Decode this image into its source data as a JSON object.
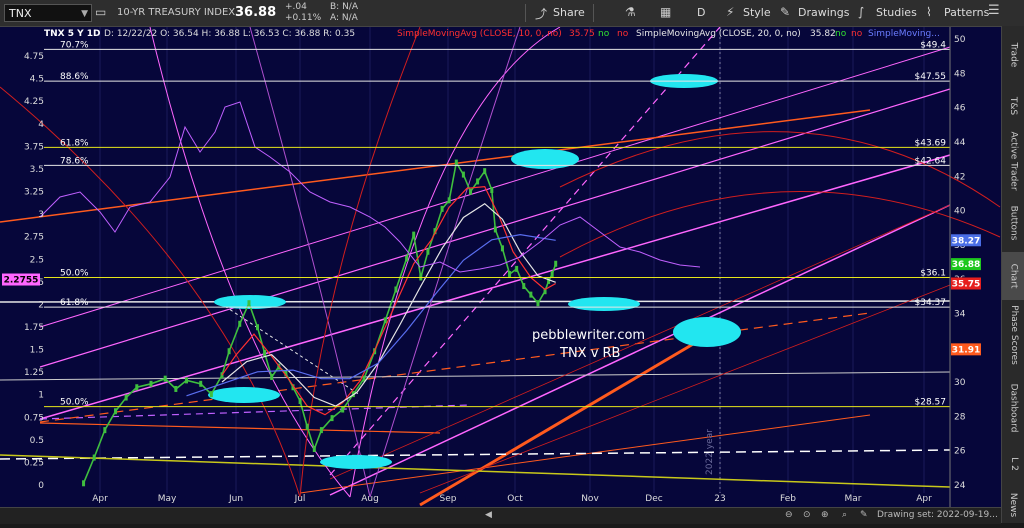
{
  "topbar": {
    "symbol": "TNX",
    "description": "10-YR TREASURY INDEX",
    "last": "36.88",
    "change": "+.04",
    "change_pct": "+0.11%",
    "bid_label": "B: N/A",
    "ask_label": "A: N/A",
    "share_label": "Share",
    "period_label": "D",
    "style_label": "Style",
    "drawings_label": "Drawings",
    "studies_label": "Studies",
    "patterns_label": "Patterns"
  },
  "sidebar": {
    "tabs": [
      "Trade",
      "T&S",
      "Active Trader",
      "Buttons",
      "Chart",
      "Phase Scores",
      "Dashboard",
      "L 2",
      "News"
    ]
  },
  "bottombar": {
    "drawing_set": "Drawing set: 2022-09-19..."
  },
  "header": {
    "title": "TNX 5 Y 1D",
    "ohlc": "D: 12/22/22  O: 36.54  H: 36.88  L: 36.53  C: 36.88  R: 0.35",
    "sma10_label": "SimpleMovingAvg (CLOSE, 10, 0, no)",
    "sma10_value": "35.75",
    "sma20_label": "SimpleMovingAvg (CLOSE, 20, 0, no)",
    "sma20_value": "35.82",
    "no": "no",
    "sma_trunc": "SimpleMoving..."
  },
  "watermark": {
    "line1": "pebblewriter.com",
    "line2": "TNX v RB",
    "year": "2022 year"
  },
  "colors": {
    "bg": "#06063a",
    "magenta": "#ff66ff",
    "orange": "#ff5a1e",
    "yellow": "#e6e61a",
    "cyan": "#22e6f0",
    "white": "#e6e6e6",
    "red": "#d21e1e",
    "blue": "#5a6ef0"
  },
  "chart_data": {
    "type": "line",
    "title": "TNX 5 Y 1D",
    "xlabel": "",
    "ylabel": "",
    "x": [
      "Apr",
      "May",
      "Jun",
      "Jul",
      "Aug",
      "Sep",
      "Oct",
      "Nov",
      "Dec",
      "23",
      "Feb",
      "Mar",
      "Apr"
    ],
    "right_axis_ticks": [
      "24",
      "26",
      "28",
      "30",
      "32",
      "34",
      "36",
      "38",
      "40",
      "42",
      "44",
      "46",
      "48",
      "50"
    ],
    "ylim": [
      24,
      50
    ],
    "left_axis_ticks": [
      "0",
      "0.25",
      "0.5",
      "0.75",
      "1",
      "1.25",
      "1.5",
      "1.75",
      "2",
      "2.25",
      "2.5",
      "2.75",
      "3",
      "3.25",
      "3.5",
      "3.75",
      "4",
      "4.25",
      "4.5",
      "4.75"
    ],
    "left_ylim": [
      0,
      4.75
    ],
    "fib_levels": [
      {
        "label": "70.7%",
        "value": 49.4,
        "right_label": "$49.4"
      },
      {
        "label": "88.6%",
        "value": 47.55,
        "right_label": "$47.55"
      },
      {
        "label": "61.8%",
        "value": 43.69,
        "right_label": "$43.69"
      },
      {
        "label": "78.6%",
        "value": 42.64,
        "right_label": "$42.64"
      },
      {
        "label": "50.0%",
        "value": 36.1,
        "right_label": "$36.1"
      },
      {
        "label": "61.8%",
        "value": 34.37,
        "right_label": "$34.37"
      },
      {
        "label": "50.0%",
        "value": 28.57,
        "right_label": "$28.57"
      }
    ],
    "price_tags": [
      {
        "value": "38.27",
        "price": 38.27,
        "color": "#4a6ee6"
      },
      {
        "value": "36.88",
        "price": 36.88,
        "color": "#1ec81e"
      },
      {
        "value": "35.75",
        "price": 35.75,
        "color": "#e61e1e"
      },
      {
        "value": "31.91",
        "price": 31.91,
        "color": "#ff5a1e"
      }
    ],
    "left_tag": {
      "value": "2.2755",
      "rate": 2.2755,
      "color": "#ff66ff"
    },
    "series": [
      {
        "name": "TNX",
        "points": [
          [
            0.05,
            24.1
          ],
          [
            0.2,
            25.6
          ],
          [
            0.35,
            27.2
          ],
          [
            0.5,
            28.3
          ],
          [
            0.65,
            29.1
          ],
          [
            0.8,
            29.7
          ],
          [
            1.0,
            29.9
          ],
          [
            1.2,
            30.2
          ],
          [
            1.35,
            29.6
          ],
          [
            1.5,
            30.1
          ],
          [
            1.7,
            29.9
          ],
          [
            1.85,
            29.3
          ],
          [
            2.0,
            30.4
          ],
          [
            2.1,
            31.8
          ],
          [
            2.25,
            33.4
          ],
          [
            2.38,
            34.6
          ],
          [
            2.5,
            33.2
          ],
          [
            2.6,
            31.7
          ],
          [
            2.7,
            30.3
          ],
          [
            2.8,
            30.9
          ],
          [
            2.9,
            30.5
          ],
          [
            3.0,
            29.7
          ],
          [
            3.1,
            28.9
          ],
          [
            3.2,
            27.4
          ],
          [
            3.3,
            26.1
          ],
          [
            3.4,
            27.2
          ],
          [
            3.55,
            27.9
          ],
          [
            3.7,
            28.4
          ],
          [
            3.85,
            29.3
          ],
          [
            4.0,
            30.2
          ],
          [
            4.15,
            31.8
          ],
          [
            4.3,
            33.6
          ],
          [
            4.45,
            35.4
          ],
          [
            4.6,
            37.2
          ],
          [
            4.7,
            38.6
          ],
          [
            4.8,
            36.1
          ],
          [
            4.9,
            37.6
          ],
          [
            5.0,
            38.8
          ],
          [
            5.1,
            40.1
          ],
          [
            5.2,
            40.6
          ],
          [
            5.3,
            42.8
          ],
          [
            5.4,
            42.1
          ],
          [
            5.5,
            41.1
          ],
          [
            5.6,
            41.7
          ],
          [
            5.7,
            42.3
          ],
          [
            5.8,
            41.2
          ],
          [
            5.85,
            38.9
          ],
          [
            5.95,
            37.8
          ],
          [
            6.05,
            36.3
          ],
          [
            6.15,
            36.6
          ],
          [
            6.25,
            35.6
          ],
          [
            6.35,
            35.1
          ],
          [
            6.45,
            34.6
          ],
          [
            6.55,
            35.3
          ],
          [
            6.6,
            35.9
          ],
          [
            6.65,
            36.3
          ],
          [
            6.7,
            36.9
          ]
        ]
      },
      {
        "name": "SMA 10",
        "points": [
          [
            2.0,
            30.4
          ],
          [
            2.2,
            31.6
          ],
          [
            2.45,
            32.8
          ],
          [
            2.7,
            31.5
          ],
          [
            2.95,
            30.1
          ],
          [
            3.2,
            28.6
          ],
          [
            3.45,
            28.1
          ],
          [
            3.7,
            28.8
          ],
          [
            3.95,
            30.1
          ],
          [
            4.2,
            32.3
          ],
          [
            4.45,
            34.6
          ],
          [
            4.7,
            36.9
          ],
          [
            4.95,
            38.3
          ],
          [
            5.2,
            40.2
          ],
          [
            5.45,
            41.3
          ],
          [
            5.7,
            41.4
          ],
          [
            5.9,
            39.7
          ],
          [
            6.1,
            37.6
          ],
          [
            6.35,
            36.1
          ],
          [
            6.55,
            35.4
          ],
          [
            6.7,
            35.75
          ]
        ]
      },
      {
        "name": "SMA 20",
        "points": [
          [
            2.0,
            30.0
          ],
          [
            2.35,
            31.2
          ],
          [
            2.7,
            31.6
          ],
          [
            3.0,
            30.4
          ],
          [
            3.3,
            29.1
          ],
          [
            3.6,
            28.6
          ],
          [
            3.9,
            29.4
          ],
          [
            4.2,
            31.1
          ],
          [
            4.5,
            33.3
          ],
          [
            4.8,
            35.6
          ],
          [
            5.1,
            37.8
          ],
          [
            5.4,
            39.6
          ],
          [
            5.7,
            40.4
          ],
          [
            5.95,
            39.5
          ],
          [
            6.2,
            37.6
          ],
          [
            6.45,
            36.2
          ],
          [
            6.7,
            35.82
          ]
        ]
      },
      {
        "name": "SMA 50",
        "points": [
          [
            1.5,
            29.2
          ],
          [
            2.0,
            29.9
          ],
          [
            2.5,
            30.6
          ],
          [
            3.0,
            30.7
          ],
          [
            3.4,
            30.2
          ],
          [
            3.8,
            30.2
          ],
          [
            4.2,
            31.1
          ],
          [
            4.6,
            33.0
          ],
          [
            5.0,
            35.1
          ],
          [
            5.4,
            37.1
          ],
          [
            5.8,
            38.3
          ],
          [
            6.2,
            38.6
          ],
          [
            6.7,
            38.27
          ]
        ]
      }
    ]
  }
}
